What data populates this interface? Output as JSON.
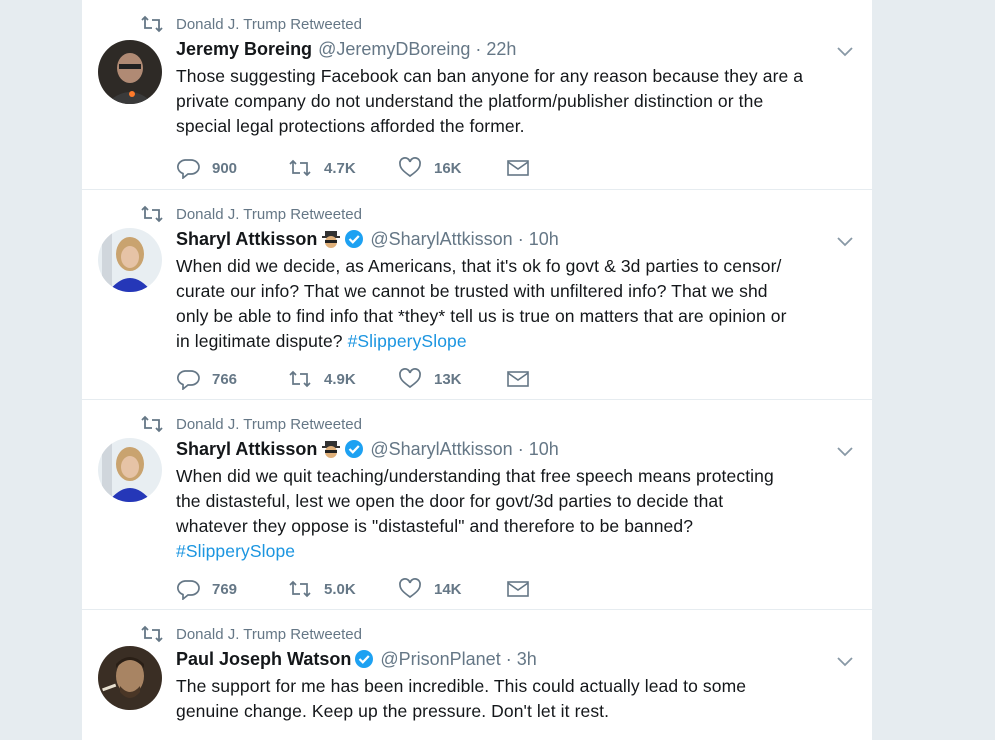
{
  "tweets": [
    {
      "retweet_context": "Donald J. Trump Retweeted",
      "name": "Jeremy Boreing",
      "handle": "@JeremyDBoreing",
      "time": "22h",
      "lines": [
        "Those suggesting Facebook can ban anyone for any reason because they are a",
        "private company do not understand the platform/publisher distinction or the",
        "special legal protections afforded the former."
      ],
      "replies": "900",
      "retweets": "4.7K",
      "likes": "16K"
    },
    {
      "retweet_context": "Donald J. Trump Retweeted",
      "name": "Sharyl Attkisson",
      "handle": "@SharylAttkisson",
      "time": "10h",
      "lines": [
        "When did we decide, as Americans, that it's ok fo govt & 3d parties to censor/",
        "curate our info? That we cannot be trusted with unfiltered info? That we shd",
        "only be able to find info that *they* tell us is true on matters that are opinion or",
        "in legitimate dispute?"
      ],
      "hashtag": "#SlipperySlope",
      "replies": "766",
      "retweets": "4.9K",
      "likes": "13K"
    },
    {
      "retweet_context": "Donald J. Trump Retweeted",
      "name": "Sharyl Attkisson",
      "handle": "@SharylAttkisson",
      "time": "10h",
      "lines": [
        "When did we quit teaching/understanding that free speech means protecting",
        "the distasteful, lest we open the door for govt/3d parties to decide that",
        "whatever they oppose is \"distasteful\" and therefore to be banned?"
      ],
      "hashtag": "#SlipperySlope",
      "replies": "769",
      "retweets": "5.0K",
      "likes": "14K"
    },
    {
      "retweet_context": "Donald J. Trump Retweeted",
      "name": "Paul Joseph Watson",
      "handle": "@PrisonPlanet",
      "time": "3h",
      "lines": [
        "The support for me has been incredible. This could actually lead to some",
        "genuine change. Keep up the pressure. Don't let it rest."
      ]
    }
  ],
  "colors": {
    "background": "#e6ecf0",
    "text": "#14171a",
    "muted": "#657786",
    "link": "#1b95e0",
    "verified": "#1da1f2"
  },
  "icons": [
    "retweet-icon",
    "caret-down-icon",
    "verified-icon",
    "spy-emoji-icon",
    "reply-icon",
    "heart-icon",
    "envelope-icon"
  ]
}
